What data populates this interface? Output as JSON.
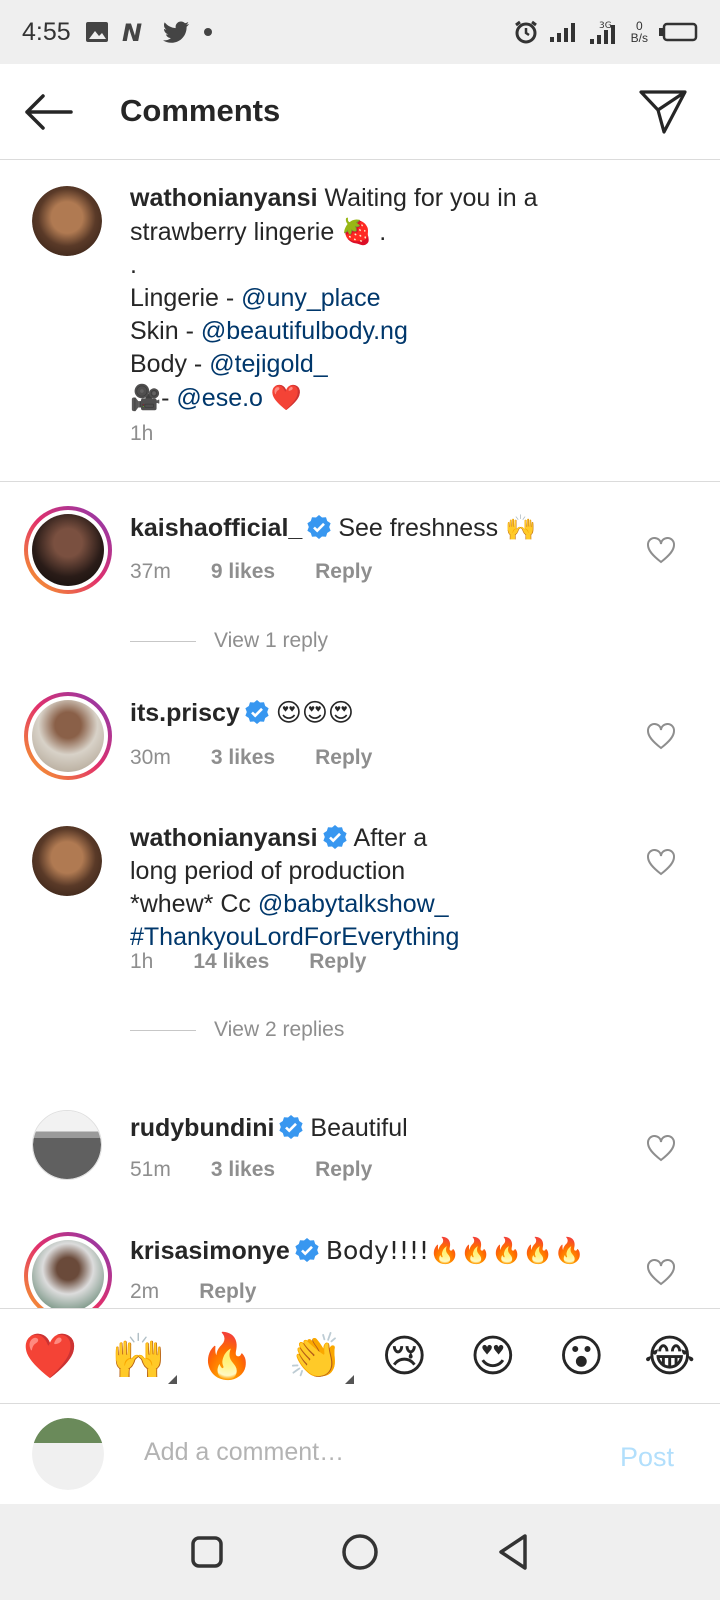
{
  "status_bar": {
    "time": "4:55",
    "left_icons": [
      "image-icon",
      "netflix-n-icon",
      "twitter-bird-icon",
      "dot-icon"
    ],
    "right_icons": [
      "alarm-icon",
      "signal-icon",
      "signal-3g-icon",
      "battery-icon"
    ],
    "net_speed_value": "0",
    "net_speed_unit": "B/s"
  },
  "header": {
    "title": "Comments",
    "back_icon": "arrow-left-icon",
    "send_icon": "send-direct-icon"
  },
  "caption": {
    "username": "wathonianyansi",
    "text_intro": " Waiting for you in a strawberry lingerie ",
    "strawberry": "🍓",
    "text_after": " .",
    "dot_line": ".",
    "credits": [
      {
        "label": "Lingerie - ",
        "handle": "@uny_place",
        "suffix": ""
      },
      {
        "label": "Skin - ",
        "handle": "@beautifulbody.ng",
        "suffix": ""
      },
      {
        "label": "Body - ",
        "handle": "@tejigold_",
        "suffix": ""
      }
    ],
    "camera_emoji": "🎥",
    "camera_label": "- ",
    "camera_handle": "@ese.o",
    "camera_suffix": " ❤️",
    "time": "1h"
  },
  "comments": [
    {
      "username": "kaishaofficial_",
      "verified": true,
      "text": "See freshness 🙌",
      "time": "37m",
      "likes": "9 likes",
      "reply": "Reply",
      "view_replies": "View 1 reply"
    },
    {
      "username": "its.priscy",
      "verified": true,
      "text": "😍😍😍",
      "time": "30m",
      "likes": "3 likes",
      "reply": "Reply"
    },
    {
      "username": "wathonianyansi",
      "verified": true,
      "text_line1": "After a",
      "text_line2": "long period of production",
      "text_line3_prefix": "*whew* Cc ",
      "mention": "@babytalkshow_",
      "hashtag": "#ThankyouLordForEverything",
      "time": "1h",
      "likes": "14 likes",
      "reply": "Reply",
      "view_replies": "View 2 replies"
    },
    {
      "username": "rudybundini",
      "verified": true,
      "text": "Beautiful",
      "time": "51m",
      "likes": "3 likes",
      "reply": "Reply"
    },
    {
      "username": "krisasimonye",
      "verified": true,
      "text": "Body!!!!🔥🔥🔥🔥🔥",
      "time": "2m",
      "reply": "Reply"
    }
  ],
  "quick_emojis": [
    "❤️",
    "🙌",
    "🔥",
    "👏",
    "😢",
    "😍",
    "😮",
    "😂"
  ],
  "comment_box": {
    "placeholder": "Add a comment…",
    "post_label": "Post"
  },
  "nav_bar": {
    "buttons": [
      "recents-square-icon",
      "home-circle-icon",
      "back-triangle-icon"
    ]
  },
  "colors": {
    "link": "#00376b",
    "meta_grey": "#8e8e8e",
    "verified_blue": "#3897f0",
    "post_disabled": "#b2dffc"
  }
}
